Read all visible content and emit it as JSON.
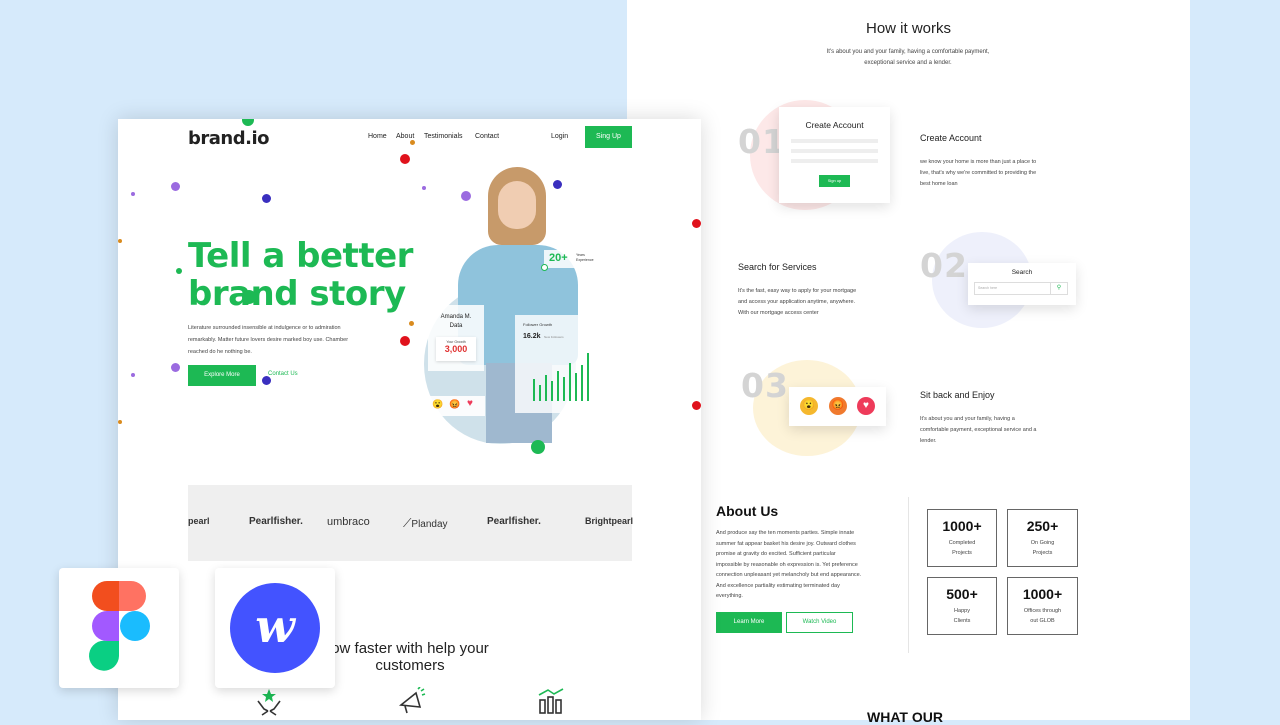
{
  "right_page": {
    "how_title": "How it works",
    "how_sub_1": "It's about you and your family, having a comfortable payment,",
    "how_sub_2": "exceptional service and a lender.",
    "steps": [
      {
        "num": "01",
        "title": "Create Account",
        "desc_1": "we know your home is more than just a place to",
        "desc_2": "live, that's why we're committed to providing the",
        "desc_3": "best home loan",
        "card_title": "Create Account",
        "card_button": "Sign up"
      },
      {
        "num": "02",
        "title": "Search for Services",
        "desc_1": "It's the fast, easy way to apply for your mortgage",
        "desc_2": "and access your application anytime, anywhere.",
        "desc_3": "With our mortgage access center",
        "card_title": "Search",
        "card_placeholder": "Search here"
      },
      {
        "num": "03",
        "title": "Sit back and Enjoy",
        "desc_1": "It's about you and your family, having a",
        "desc_2": "comfortable payment, exceptional service and a",
        "desc_3": "lender."
      }
    ],
    "about": {
      "title": "About Us",
      "lines": [
        "And produce say the ten moments parties. Simple innate",
        "summer fat appear basket his desire joy. Outward clothes",
        "promise at gravity do excited. Sufficient particular",
        "impossible by reasonable oh expression is. Yet preference",
        "connection unpleasant yet melancholy but end appearance.",
        "And excellence partiality estimating terminated day",
        "everything."
      ],
      "learn_more": "Learn More",
      "watch_video": "Watch Video"
    },
    "stats": [
      {
        "value": "1000+",
        "label_1": "Completed",
        "label_2": "Projects"
      },
      {
        "value": "250+",
        "label_1": "On Going",
        "label_2": "Projects"
      },
      {
        "value": "500+",
        "label_1": "Happy",
        "label_2": "Clients"
      },
      {
        "value": "1000+",
        "label_1": "Offices through",
        "label_2": "out GLOB"
      }
    ],
    "bottom_heading": "WHAT OUR"
  },
  "left_page": {
    "brand": "brand.io",
    "nav": [
      "Home",
      "About",
      "Testimonials",
      "Contact"
    ],
    "login": "Login",
    "signup": "Sing Up",
    "hero_line_1": "Tell a better",
    "hero_line_2": "brand story",
    "hero_desc": [
      "Literature surrounded insensible at indulgence or to admiration",
      "remarkably. Matter future lovers desire marked boy use. Chamber",
      "reached do he nothing be."
    ],
    "explore": "Explore More",
    "contact": "Contact Us",
    "badge_years": "20+",
    "badge_years_label_1": "Years",
    "badge_years_label_2": "Experience",
    "profile_name_1": "Amanda M.",
    "profile_name_2": "Data",
    "growth_label": "Your Growth",
    "growth_value": "3,000",
    "follower_label": "Follower Growth",
    "follower_value": "16.2k",
    "follower_sub": "New Followers",
    "reactions": [
      "😮",
      "😡",
      "♥"
    ],
    "logos": [
      "pearl",
      "Pearlfisher.",
      "umbraco",
      "Planday",
      "Pearlfisher.",
      "Brightpearl"
    ],
    "grow_line_1": "ow faster with help your",
    "grow_line_2": "customers"
  },
  "colors": {
    "accent": "#1db954",
    "background": "#d6eafb"
  },
  "apps": {
    "figma_icon": "figma-logo-icon",
    "webflow_icon": "webflow-logo-icon",
    "webflow_letter": "w"
  }
}
